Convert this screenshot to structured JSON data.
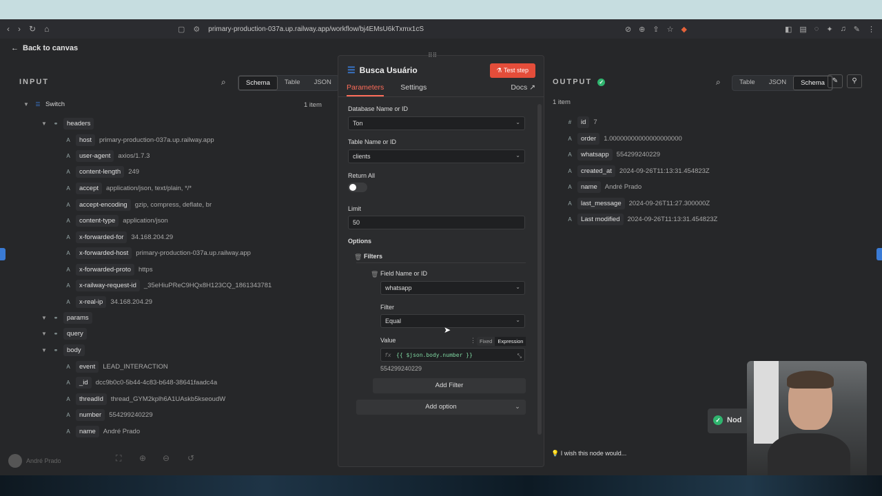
{
  "browser": {
    "url": "primary-production-037a.up.railway.app/workflow/bj4EMsU6kTxmx1cS"
  },
  "back_label": "Back to canvas",
  "input": {
    "label": "INPUT",
    "tabs": [
      "Schema",
      "Table",
      "JSON"
    ],
    "active_tab": "Schema",
    "item_count": "1 item",
    "root": "Switch",
    "groups": {
      "headers": "headers",
      "params": "params",
      "query": "query",
      "body": "body"
    },
    "header_fields": [
      {
        "key": "host",
        "value": "primary-production-037a.up.railway.app"
      },
      {
        "key": "user-agent",
        "value": "axios/1.7.3"
      },
      {
        "key": "content-length",
        "value": "249"
      },
      {
        "key": "accept",
        "value": "application/json, text/plain, */*"
      },
      {
        "key": "accept-encoding",
        "value": "gzip, compress, deflate, br"
      },
      {
        "key": "content-type",
        "value": "application/json"
      },
      {
        "key": "x-forwarded-for",
        "value": "34.168.204.29"
      },
      {
        "key": "x-forwarded-host",
        "value": "primary-production-037a.up.railway.app"
      },
      {
        "key": "x-forwarded-proto",
        "value": "https"
      },
      {
        "key": "x-railway-request-id",
        "value": "_35eHiuPReC9HQx8H123CQ_1861343781"
      },
      {
        "key": "x-real-ip",
        "value": "34.168.204.29"
      }
    ],
    "body_fields": [
      {
        "key": "event",
        "value": "LEAD_INTERACTION"
      },
      {
        "key": "_id",
        "value": "dcc9b0c0-5b44-4c83-b648-38641faadc4a"
      },
      {
        "key": "threadId",
        "value": "thread_GYM2kplh6A1UAskb5kseoudW"
      },
      {
        "key": "number",
        "value": "554299240229"
      },
      {
        "key": "name",
        "value": "André Prado"
      }
    ]
  },
  "node": {
    "title": "Busca Usuário",
    "test_step": "Test step",
    "tabs": {
      "parameters": "Parameters",
      "settings": "Settings",
      "docs": "Docs"
    },
    "db_label": "Database Name or ID",
    "db_value": "Ton",
    "table_label": "Table Name or ID",
    "table_value": "clients",
    "return_all_label": "Return All",
    "limit_label": "Limit",
    "limit_value": "50",
    "options_label": "Options",
    "filters_label": "Filters",
    "field_label": "Field Name or ID",
    "field_value": "whatsapp",
    "filter_label": "Filter",
    "filter_value": "Equal",
    "value_label": "Value",
    "value_modes": {
      "fixed": "Fixed",
      "expression": "Expression"
    },
    "value_expr": "{{ $json.body.number }}",
    "value_preview": "554299240229",
    "add_filter": "Add Filter",
    "add_option": "Add option"
  },
  "output": {
    "label": "OUTPUT",
    "tabs": [
      "Table",
      "JSON",
      "Schema"
    ],
    "active_tab": "Schema",
    "item_count": "1 item",
    "fields": [
      {
        "type": "#",
        "key": "id",
        "value": "7"
      },
      {
        "type": "A",
        "key": "order",
        "value": "1.00000000000000000000"
      },
      {
        "type": "A",
        "key": "whatsapp",
        "value": "554299240229"
      },
      {
        "type": "A",
        "key": "created_at",
        "value": "2024-09-26T11:13:31.454823Z"
      },
      {
        "type": "A",
        "key": "name",
        "value": "André Prado"
      },
      {
        "type": "A",
        "key": "last_message",
        "value": "2024-09-26T11:27.300000Z"
      },
      {
        "type": "A",
        "key": "Last modified",
        "value": "2024-09-26T11:13:31.454823Z"
      }
    ]
  },
  "toast": "Nod",
  "wish": "I wish this node would...",
  "user": "André Prado",
  "colors": {
    "accent": "#ff6d5a",
    "success": "#2fb46e"
  }
}
